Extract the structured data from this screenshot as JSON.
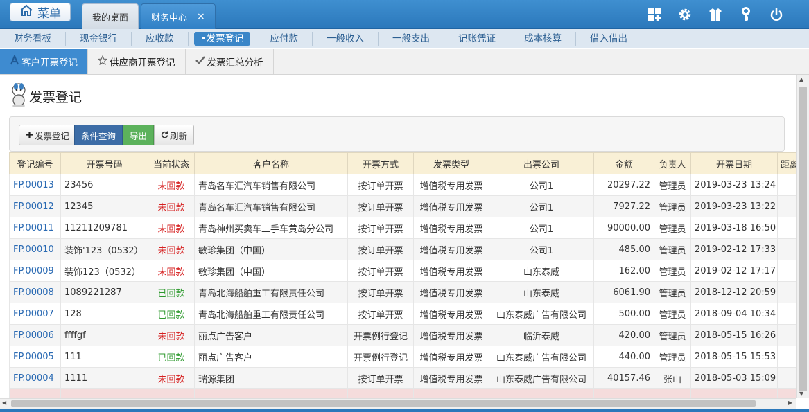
{
  "header": {
    "home_label": "菜单",
    "tabs": [
      {
        "label": "我的桌面"
      },
      {
        "label": "财务中心",
        "close": "×"
      }
    ]
  },
  "module_nav": [
    "财务看板",
    "现金银行",
    "应收款",
    "•发票登记",
    "应付款",
    "一般收入",
    "一般支出",
    "记账凭证",
    "成本核算",
    "借入借出"
  ],
  "sub_tabs": [
    "客户开票登记",
    "供应商开票登记",
    "发票汇总分析"
  ],
  "page_title": "发票登记",
  "toolbar": {
    "register": "发票登记",
    "query": "条件查询",
    "export": "导出",
    "refresh": "刷新"
  },
  "table": {
    "columns": [
      "登记编号",
      "开票号码",
      "当前状态",
      "客户名称",
      "开票方式",
      "发票类型",
      "出票公司",
      "金额",
      "负责人",
      "开票日期",
      "距离"
    ],
    "rows": [
      {
        "id": "FP.00013",
        "no": "23456",
        "status": "未回款",
        "customer": "青岛名车汇汽车销售有限公司",
        "method": "按订单开票",
        "type": "增值税专用发票",
        "company": "公司1",
        "amount": "20297.22",
        "owner": "管理员",
        "date": "2019-03-23 13:24",
        "extra": "-"
      },
      {
        "id": "FP.00012",
        "no": "12345",
        "status": "未回款",
        "customer": "青岛名车汇汽车销售有限公司",
        "method": "按订单开票",
        "type": "增值税专用发票",
        "company": "公司1",
        "amount": "7927.22",
        "owner": "管理员",
        "date": "2019-03-23 13:22",
        "extra": "-"
      },
      {
        "id": "FP.00011",
        "no": "11211209781",
        "status": "未回款",
        "customer": "青岛神州买卖车二手车黄岛分公司",
        "method": "按订单开票",
        "type": "增值税专用发票",
        "company": "公司1",
        "amount": "90000.00",
        "owner": "管理员",
        "date": "2019-03-18 16:50",
        "extra": "-"
      },
      {
        "id": "FP.00010",
        "no": "装饰'123（0532）",
        "status": "未回款",
        "customer": "敏珍集团（中国）",
        "method": "按订单开票",
        "type": "增值税专用发票",
        "company": "公司1",
        "amount": "485.00",
        "owner": "管理员",
        "date": "2019-02-12 17:33",
        "extra": "-"
      },
      {
        "id": "FP.00009",
        "no": "装饰123（0532）",
        "status": "未回款",
        "customer": "敏珍集团（中国）",
        "method": "按订单开票",
        "type": "增值税专用发票",
        "company": "山东泰威",
        "amount": "162.00",
        "owner": "管理员",
        "date": "2019-02-12 17:17",
        "extra": "-"
      },
      {
        "id": "FP.00008",
        "no": "1089221287",
        "status": "已回款",
        "customer": "青岛北海船舶重工有限责任公司",
        "method": "按订单开票",
        "type": "增值税专用发票",
        "company": "山东泰威",
        "amount": "6061.90",
        "owner": "管理员",
        "date": "2018-12-12 20:59",
        "extra": ""
      },
      {
        "id": "FP.00007",
        "no": "128",
        "status": "已回款",
        "customer": "青岛北海船舶重工有限责任公司",
        "method": "按订单开票",
        "type": "增值税专用发票",
        "company": "山东泰威广告有限公司",
        "amount": "500.00",
        "owner": "管理员",
        "date": "2018-09-04 10:34",
        "extra": ""
      },
      {
        "id": "FP.00006",
        "no": "ffffgf",
        "status": "未回款",
        "customer": "丽点广告客户",
        "method": "开票例行登记",
        "type": "增值税专用发票",
        "company": "临沂泰威",
        "amount": "420.00",
        "owner": "管理员",
        "date": "2018-05-15 16:26",
        "extra": "-"
      },
      {
        "id": "FP.00005",
        "no": "111",
        "status": "已回款",
        "customer": "丽点广告客户",
        "method": "开票例行登记",
        "type": "增值税专用发票",
        "company": "山东泰威广告有限公司",
        "amount": "440.00",
        "owner": "管理员",
        "date": "2018-05-15 15:53",
        "extra": ""
      },
      {
        "id": "FP.00004",
        "no": "1111",
        "status": "未回款",
        "customer": "瑞源集团",
        "method": "按订单开票",
        "type": "增值税专用发票",
        "company": "山东泰威广告有限公司",
        "amount": "40157.46",
        "owner": "张山",
        "date": "2018-05-03 15:09",
        "extra": "-"
      }
    ]
  },
  "colors": {
    "accent": "#3a86c8",
    "unpaid": "#d62020",
    "paid": "#2f9a2f",
    "link": "#2a6ab3"
  }
}
